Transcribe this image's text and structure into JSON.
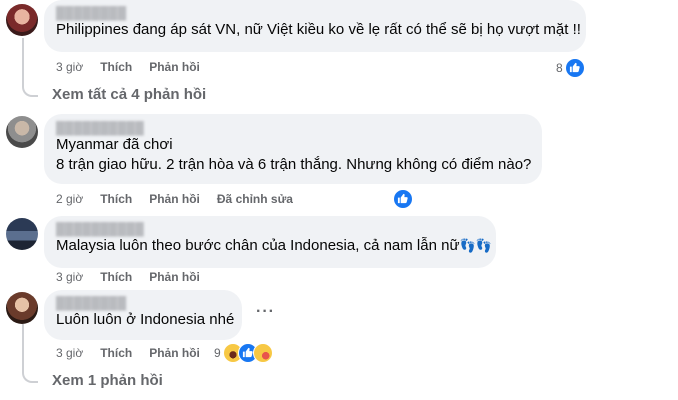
{
  "comments": [
    {
      "text": "Philippines đang áp sát VN, nữ Việt kiều ko về lẹ rất có thể sẽ bị họ vượt mặt !!",
      "time": "3 giờ",
      "like": "Thích",
      "reply": "Phản hồi",
      "reaction_count": "8"
    },
    {
      "lines": [
        "Myanmar đã chơi",
        "8 trận giao hữu. 2 trận hòa và 6 trận thắng. Nhưng không có điểm nào?"
      ],
      "time": "2 giờ",
      "like": "Thích",
      "reply": "Phản hồi",
      "edited": "Đã chỉnh sửa"
    },
    {
      "text": "Malaysia luôn theo bước chân của Indonesia, cả nam lẫn nữ",
      "time": "3 giờ",
      "like": "Thích",
      "reply": "Phản hồi"
    },
    {
      "text": "Luôn luôn ở Indonesia nhé",
      "time": "3 giờ",
      "like": "Thích",
      "reply": "Phản hồi",
      "reaction_count": "9"
    }
  ],
  "view_all_replies": "Xem tất cả 4 phản hồi",
  "view_one_reply": "Xem 1 phản hồi",
  "colors": {
    "bubble": "#f0f2f5",
    "meta": "#65676b",
    "like_blue": "#1877f2"
  }
}
